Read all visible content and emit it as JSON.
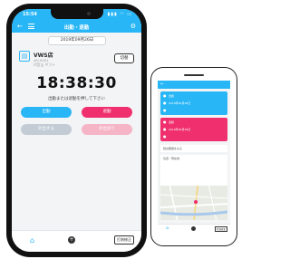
{
  "large_phone": {
    "status": {
      "time": "15:54",
      "icons": "▮▮▮ ◠ ▭"
    },
    "header": {
      "title": "出勤・退勤"
    },
    "date": "2019年09月26日",
    "shop": {
      "name": "VWS店",
      "code": "#V-0001",
      "location": "代官山  ギフト",
      "switch_label": "切替"
    },
    "clock": "18:38:30",
    "prompt": "出勤または退勤を押して下さい",
    "buttons": {
      "clock_in": "出勤",
      "clock_out": "退勤",
      "go_out": "外出する",
      "return": "外出戻り"
    },
    "tabbar": {
      "fix_label": "打刻修正"
    }
  },
  "small_phone": {
    "cards": [
      {
        "label": "出勤",
        "detail": "2019年09月26日"
      },
      {
        "label": "退勤",
        "detail": "2019年09月26日"
      }
    ],
    "strip": "勤怠履歴をみる",
    "map_label": "位置・現在地",
    "tabbar": {
      "fix_label": "打刻修正"
    }
  }
}
